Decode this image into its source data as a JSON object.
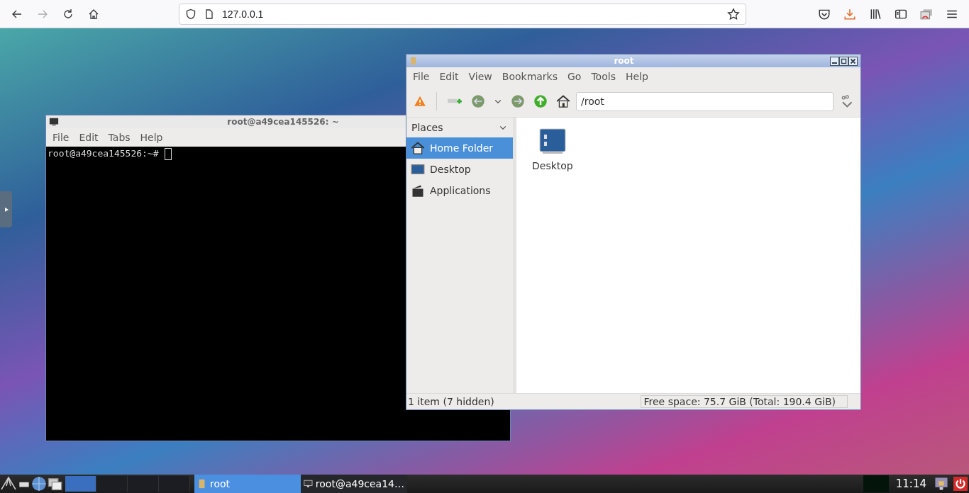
{
  "browser": {
    "url": "127.0.0.1"
  },
  "terminal": {
    "title": "root@a49cea145526: ~",
    "menu": [
      "File",
      "Edit",
      "Tabs",
      "Help"
    ],
    "prompt": "root@a49cea145526:~#"
  },
  "file_manager": {
    "title": "root",
    "menu": [
      "File",
      "Edit",
      "View",
      "Bookmarks",
      "Go",
      "Tools",
      "Help"
    ],
    "path": "/root",
    "places": {
      "title": "Places",
      "items": [
        {
          "label": "Home Folder",
          "kind": "home",
          "selected": true
        },
        {
          "label": "Desktop",
          "kind": "desktop",
          "selected": false
        },
        {
          "label": "Applications",
          "kind": "apps",
          "selected": false
        }
      ]
    },
    "files": [
      {
        "label": "Desktop"
      }
    ],
    "status_left": "1 item (7 hidden)",
    "status_right": "Free space: 75.7 GiB (Total: 190.4 GiB)"
  },
  "taskbar": {
    "pager": [
      {
        "selected": true
      },
      {
        "selected": false
      },
      {
        "selected": false
      },
      {
        "selected": false
      }
    ],
    "tasks": [
      {
        "label": "root",
        "kind": "folder",
        "selected": true
      },
      {
        "label": "root@a49cea14…",
        "kind": "terminal",
        "selected": false
      }
    ],
    "clock": "11:14"
  }
}
